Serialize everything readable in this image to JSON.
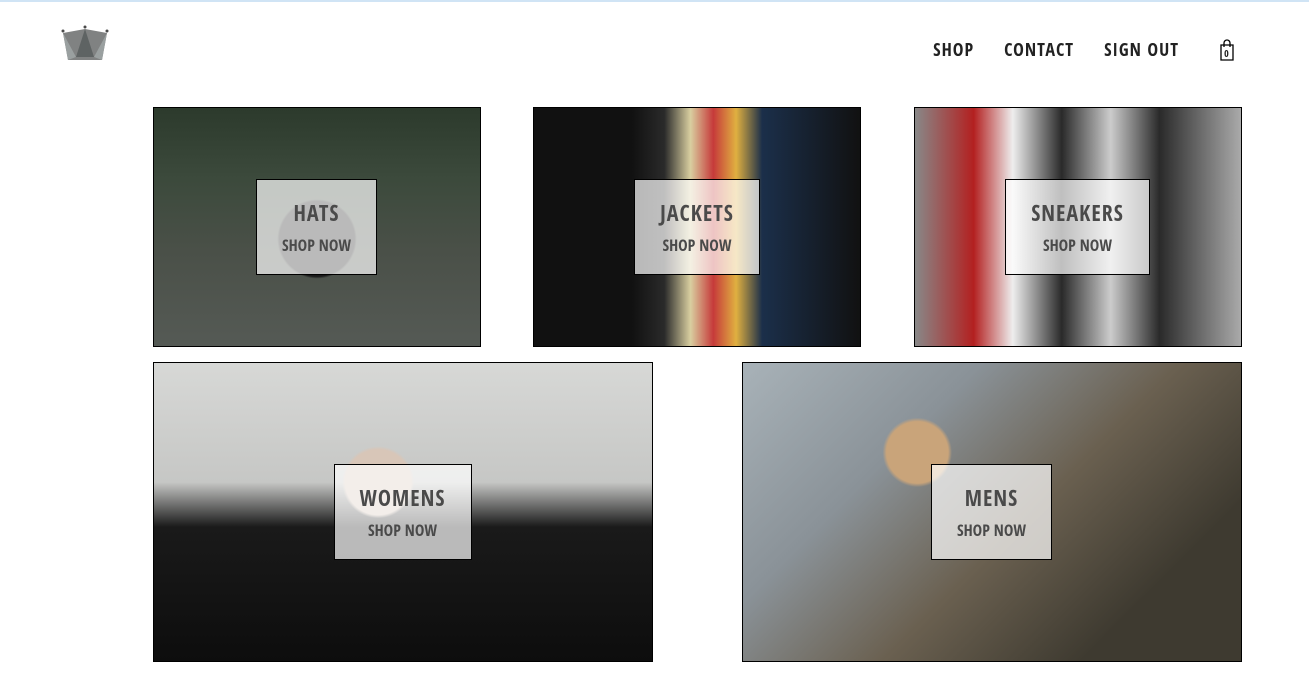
{
  "nav": {
    "shop": "SHOP",
    "contact": "CONTACT",
    "signout": "SIGN OUT"
  },
  "cart": {
    "count": "0"
  },
  "categories": {
    "hats": {
      "title": "HATS",
      "subtitle": "SHOP NOW"
    },
    "jackets": {
      "title": "JACKETS",
      "subtitle": "SHOP NOW"
    },
    "sneakers": {
      "title": "SNEAKERS",
      "subtitle": "SHOP NOW"
    },
    "womens": {
      "title": "WOMENS",
      "subtitle": "SHOP NOW"
    },
    "mens": {
      "title": "MENS",
      "subtitle": "SHOP NOW"
    }
  }
}
